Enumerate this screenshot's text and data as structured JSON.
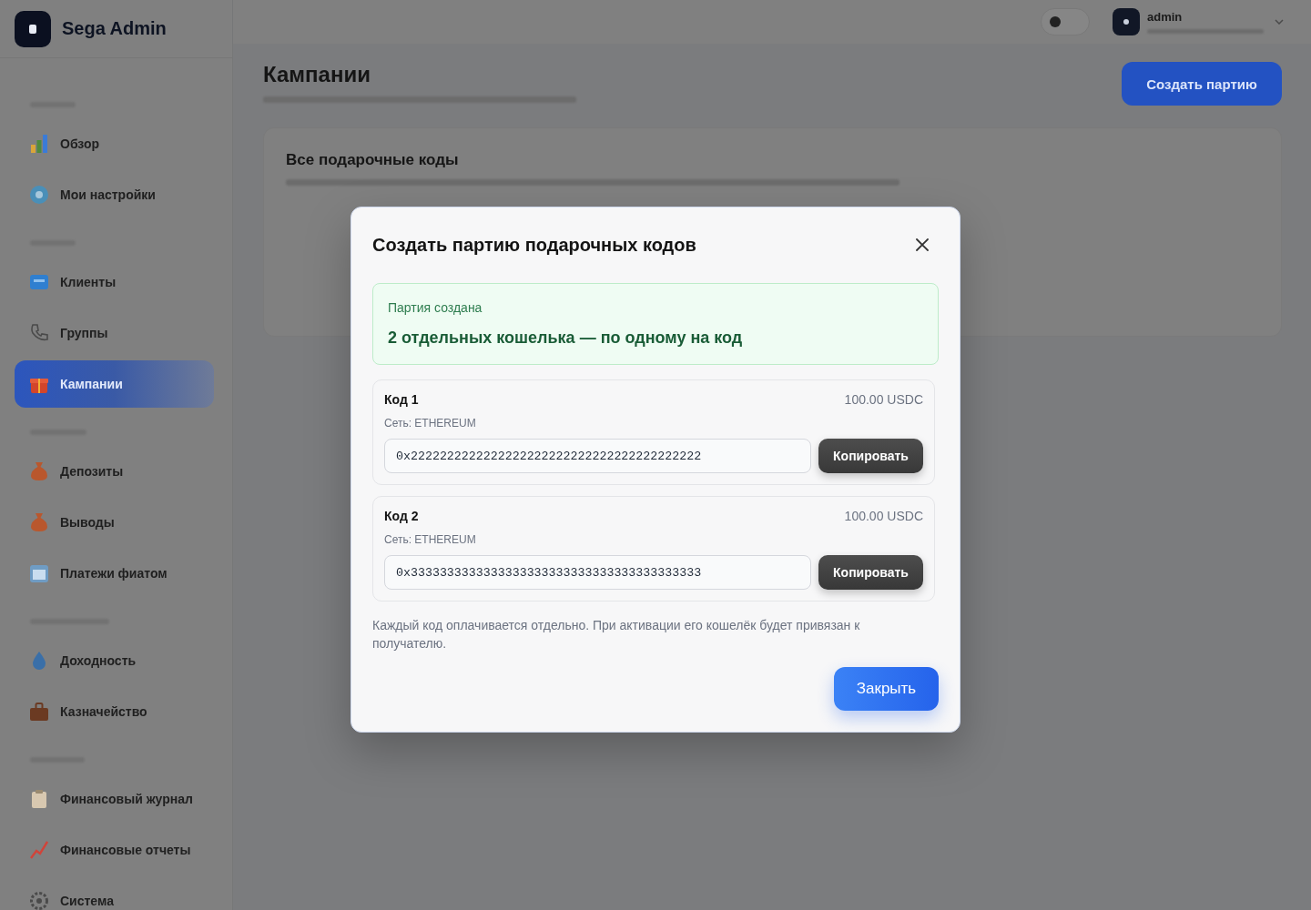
{
  "sidebar": {
    "brand": "Sega Admin",
    "sections": [
      {
        "items": [
          {
            "label": "Обзор",
            "selected": false
          },
          {
            "label": "Мои настройки",
            "selected": false
          }
        ]
      },
      {
        "items": [
          {
            "label": "Клиенты",
            "selected": false
          },
          {
            "label": "Группы",
            "selected": false
          },
          {
            "label": "Кампании",
            "selected": true
          }
        ]
      },
      {
        "items": [
          {
            "label": "Депозиты",
            "selected": false
          },
          {
            "label": "Выводы",
            "selected": false
          },
          {
            "label": "Платежи фиатом",
            "selected": false
          }
        ]
      },
      {
        "items": [
          {
            "label": "Доходность",
            "selected": false
          },
          {
            "label": "Казначейство",
            "selected": false
          }
        ]
      },
      {
        "items": [
          {
            "label": "Финансовый журнал",
            "selected": false
          },
          {
            "label": "Финансовые отчеты",
            "selected": false
          },
          {
            "label": "Система",
            "selected": false
          }
        ]
      }
    ]
  },
  "topbar": {
    "theme_toggle": {
      "on": false
    },
    "user": {
      "name": "admin"
    }
  },
  "page": {
    "title": "Кампании",
    "action": "Создать партию"
  },
  "card": {
    "title": "Все подарочные коды"
  },
  "modal": {
    "title": "Создать партию подарочных кодов",
    "success": {
      "label": "Партия создана",
      "message": "2 отдельных кошелька — по одному на код"
    },
    "codes": [
      {
        "title": "Код 1",
        "amount": "100.00 USDC",
        "network": "Сеть: ETHEREUM",
        "address": "0x2222222222222222222222222222222222222222",
        "action": "Копировать"
      },
      {
        "title": "Код 2",
        "amount": "100.00 USDC",
        "network": "Сеть: ETHEREUM",
        "address": "0x3333333333333333333333333333333333333333",
        "action": "Копировать"
      }
    ],
    "note": "Каждый код оплачивается отдельно. При активации его кошелёк будет привязан к получателю.",
    "close_button": "Закрыть"
  }
}
